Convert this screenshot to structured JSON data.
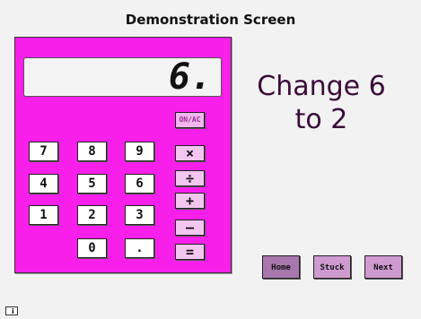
{
  "header": {
    "title": "Demonstration Screen"
  },
  "calculator": {
    "display_value": "6.",
    "on_ac_label": "ON/AC",
    "digit_keys": {
      "k7": "7",
      "k8": "8",
      "k9": "9",
      "k4": "4",
      "k5": "5",
      "k6": "6",
      "k1": "1",
      "k2": "2",
      "k3": "3",
      "k0": "0",
      "dot": "."
    },
    "operator_keys": {
      "multiply": "×",
      "divide": "÷",
      "plus": "+",
      "minus": "–",
      "equals": "="
    },
    "body_color": "#f71fe9"
  },
  "instruction": {
    "line1": "Change 6",
    "line2": "to 2"
  },
  "nav": {
    "home": "Home",
    "stuck": "Stuck",
    "next": "Next"
  },
  "info_button": {
    "label": "i"
  }
}
